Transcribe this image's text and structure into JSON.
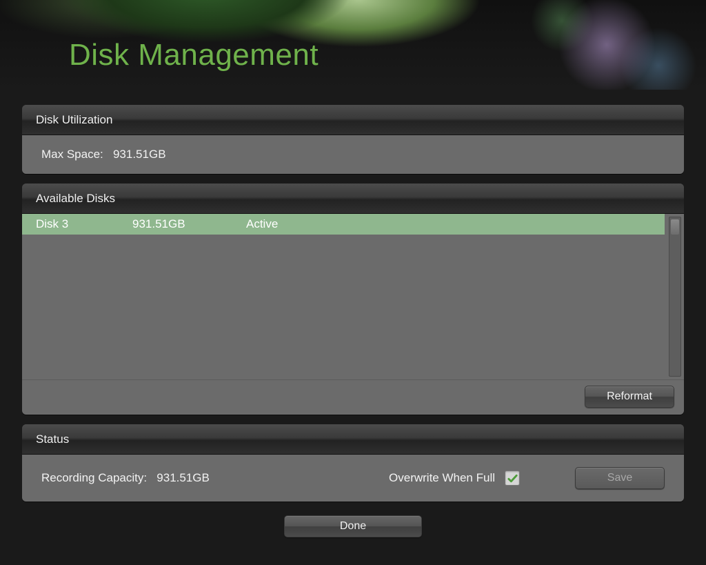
{
  "page": {
    "title": "Disk Management"
  },
  "utilization": {
    "header": "Disk Utilization",
    "max_space_label": "Max Space:",
    "max_space_value": "931.51GB"
  },
  "available": {
    "header": "Available Disks",
    "reformat_label": "Reformat",
    "disks": [
      {
        "name": "Disk 3",
        "size": "931.51GB",
        "state": "Active",
        "selected": true
      }
    ]
  },
  "status": {
    "header": "Status",
    "recording_capacity_label": "Recording Capacity:",
    "recording_capacity_value": "931.51GB",
    "overwrite_label": "Overwrite When Full",
    "overwrite_checked": true,
    "save_label": "Save",
    "save_disabled": true
  },
  "footer": {
    "done_label": "Done"
  },
  "colors": {
    "accent": "#6fb24b",
    "row_selected": "#8fb78e"
  }
}
